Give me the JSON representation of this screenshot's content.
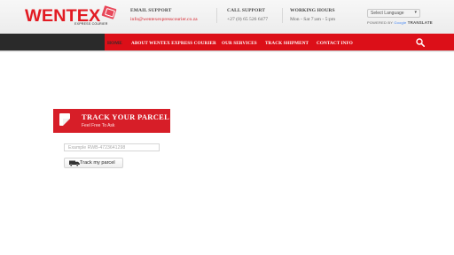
{
  "logo": {
    "text": "WENTEX",
    "sub": "EXPRESS COURIER"
  },
  "header": {
    "email": {
      "label": "EMAIL SUPPORT",
      "value": "info@wentexexpresscourier.co.za"
    },
    "call": {
      "label": "CALL SUPPORT",
      "value": "+27 (0) 65 526 6477"
    },
    "hours": {
      "label": "WORKING HOURS",
      "value": "Mon - Sat 7:am - 5:pm"
    },
    "language": {
      "selected": "Select Language",
      "powered_prefix": "POWERED BY",
      "powered_brand": "Google",
      "powered_suffix": "TRANSLATE"
    }
  },
  "nav": {
    "items": [
      "HOME",
      "ABOUT WENTEX EXPRESS COURIER",
      "OUR SERVICES",
      "TRACK SHIPMENT",
      "CONTACT INFO"
    ],
    "search_icon": "search-icon"
  },
  "track": {
    "title": "TRACK YOUR PARCEL",
    "subtitle": "Feel Free To Ask",
    "input_placeholder": "Example RWB-4723641298",
    "button_label": "Track my parcel",
    "button_icon": "truck-icon"
  },
  "colors": {
    "brand_red": "#dc0f18",
    "dark": "#2a2a2a"
  }
}
